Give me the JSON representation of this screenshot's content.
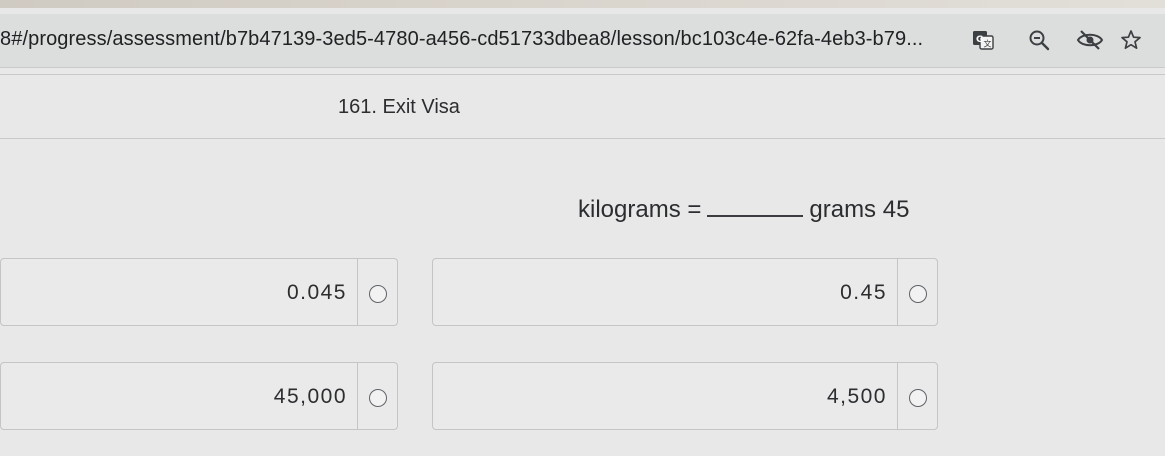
{
  "browser": {
    "url": "8#/progress/assessment/b7b47139-3ed5-4780-a456-cd51733dbea8/lesson/bc103c4e-62fa-4eb3-b79...",
    "icons": [
      "translate-icon",
      "zoom-icon",
      "eye-off-icon",
      "star-icon"
    ]
  },
  "lesson": {
    "title": "161. Exit Visa"
  },
  "question": {
    "prefix": "kilograms =",
    "suffix": "grams 45"
  },
  "choices": [
    {
      "label": "0.045"
    },
    {
      "label": "0.45"
    },
    {
      "label": "45,000"
    },
    {
      "label": "4,500"
    }
  ],
  "colors": {
    "background": "#e7e8e7",
    "address_bar": "#dcdedd",
    "text": "#2b2d30"
  }
}
